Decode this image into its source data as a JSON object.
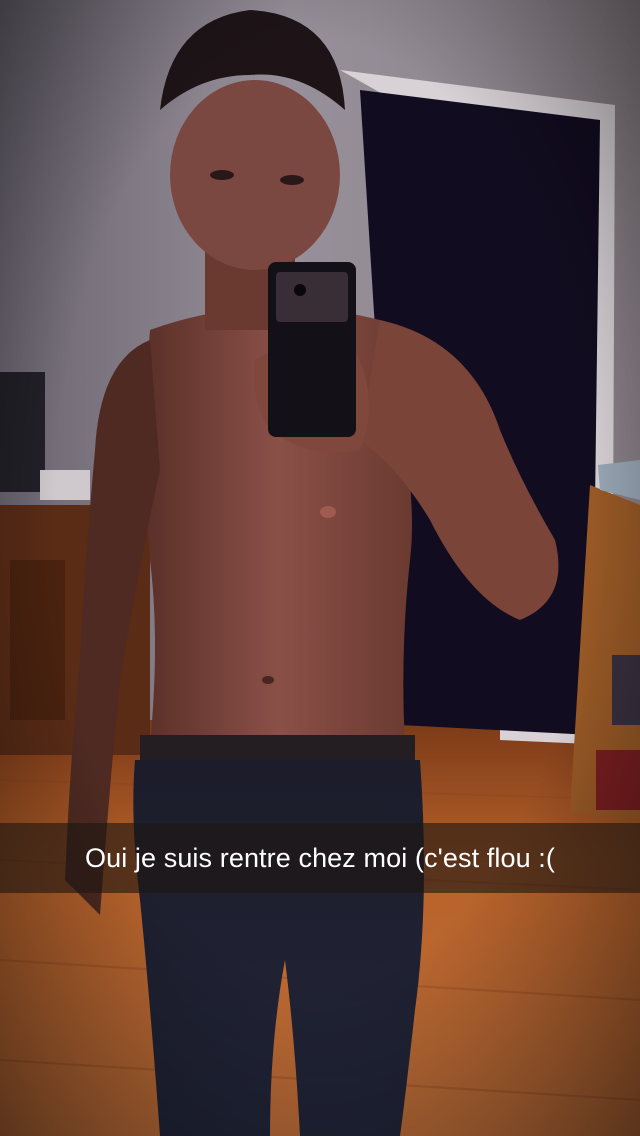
{
  "snap": {
    "caption": "Oui je suis rentre chez moi (c'est flou :(",
    "photo_subject": "mirror-selfie",
    "colors": {
      "wall": "#8a8290",
      "floor": "#b5602a",
      "door": "#120c20",
      "caption_bar": "#1e1612"
    }
  }
}
